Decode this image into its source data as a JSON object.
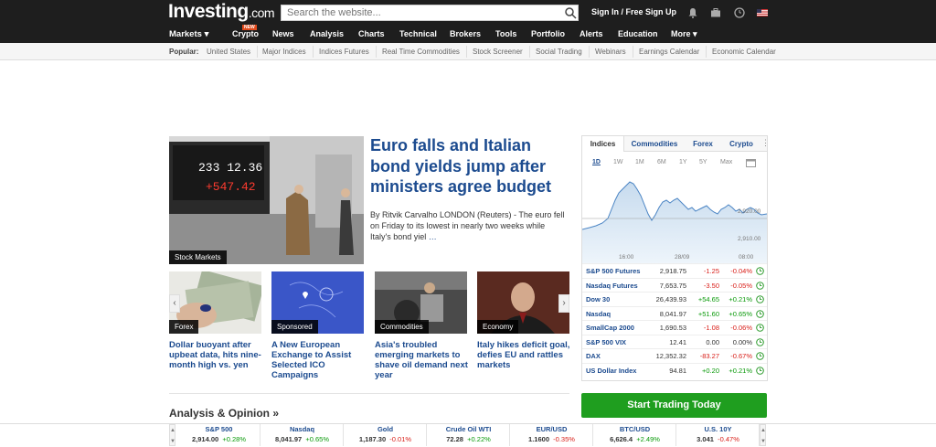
{
  "header": {
    "logo": "Investing",
    "logo_suffix": ".com",
    "search_placeholder": "Search the website...",
    "signin": "Sign In / Free Sign Up"
  },
  "nav": {
    "items": [
      "Markets",
      "Crypto",
      "News",
      "Analysis",
      "Charts",
      "Technical",
      "Brokers",
      "Tools",
      "Portfolio",
      "Alerts",
      "Education",
      "More"
    ],
    "new_badge": "NEW"
  },
  "popular": {
    "label": "Popular:",
    "items": [
      "United States",
      "Major Indices",
      "Indices Futures",
      "Real Time Commodities",
      "Stock Screener",
      "Social Trading",
      "Webinars",
      "Earnings Calendar",
      "Economic Calendar"
    ]
  },
  "main_story": {
    "tag": "Stock Markets",
    "board_top": "233 12.36",
    "board_bottom": "+547.42",
    "headline": "Euro falls and Italian bond yields jump after ministers agree budget",
    "excerpt": "By Ritvik Carvalho LONDON (Reuters) - The euro fell on Friday to its lowest in nearly two weeks while Italy's bond yiel",
    "more": "…"
  },
  "stories": [
    {
      "tag": "Forex",
      "title": "Dollar buoyant after upbeat data, hits nine-month high vs. yen"
    },
    {
      "tag": "Sponsored",
      "title": "A New European Exchange to Assist Selected ICO Campaigns"
    },
    {
      "tag": "Commodities",
      "title": "Asia's troubled emerging markets to shave oil demand next year"
    },
    {
      "tag": "Economy",
      "title": "Italy hikes deficit goal, defies EU and rattles markets"
    }
  ],
  "analysis_title": "Analysis & Opinion »",
  "widget": {
    "tabs": [
      "Indices",
      "Commodities",
      "Forex",
      "Crypto"
    ],
    "ranges": [
      "1D",
      "1W",
      "1M",
      "6M",
      "1Y",
      "5Y",
      "Max"
    ],
    "chart_labels": {
      "y_high": "2,920.00",
      "y_low": "2,910.00",
      "x": [
        "16:00",
        "28/09",
        "08:00"
      ]
    },
    "quotes": [
      {
        "name": "S&P 500 Futures",
        "last": "2,918.75",
        "chg": "-1.25",
        "pct": "-0.04%"
      },
      {
        "name": "Nasdaq Futures",
        "last": "7,653.75",
        "chg": "-3.50",
        "pct": "-0.05%"
      },
      {
        "name": "Dow 30",
        "last": "26,439.93",
        "chg": "+54.65",
        "pct": "+0.21%"
      },
      {
        "name": "Nasdaq",
        "last": "8,041.97",
        "chg": "+51.60",
        "pct": "+0.65%"
      },
      {
        "name": "SmallCap 2000",
        "last": "1,690.53",
        "chg": "-1.08",
        "pct": "-0.06%"
      },
      {
        "name": "S&P 500 VIX",
        "last": "12.41",
        "chg": "0.00",
        "pct": "0.00%"
      },
      {
        "name": "DAX",
        "last": "12,352.32",
        "chg": "-83.27",
        "pct": "-0.67%"
      },
      {
        "name": "US Dollar Index",
        "last": "94.81",
        "chg": "+0.20",
        "pct": "+0.21%"
      }
    ]
  },
  "cta": "Start Trading Today",
  "ticker": [
    {
      "name": "S&P 500",
      "last": "2,914.00",
      "chg": "+0.28%"
    },
    {
      "name": "Nasdaq",
      "last": "8,041.97",
      "chg": "+0.65%"
    },
    {
      "name": "Gold",
      "last": "1,187.30",
      "chg": "-0.01%"
    },
    {
      "name": "Crude Oil WTI",
      "last": "72.28",
      "chg": "+0.22%"
    },
    {
      "name": "EUR/USD",
      "last": "1.1600",
      "chg": "-0.35%"
    },
    {
      "name": "BTC/USD",
      "last": "6,626.4",
      "chg": "+2.49%"
    },
    {
      "name": "U.S. 10Y",
      "last": "3.041",
      "chg": "-0.47%"
    }
  ],
  "colors": {
    "brand_blue": "#1c4b8f",
    "positive": "#0a9a0a",
    "negative": "#d91e18",
    "cta": "#1f9e1f",
    "header": "#1e1e1e"
  }
}
